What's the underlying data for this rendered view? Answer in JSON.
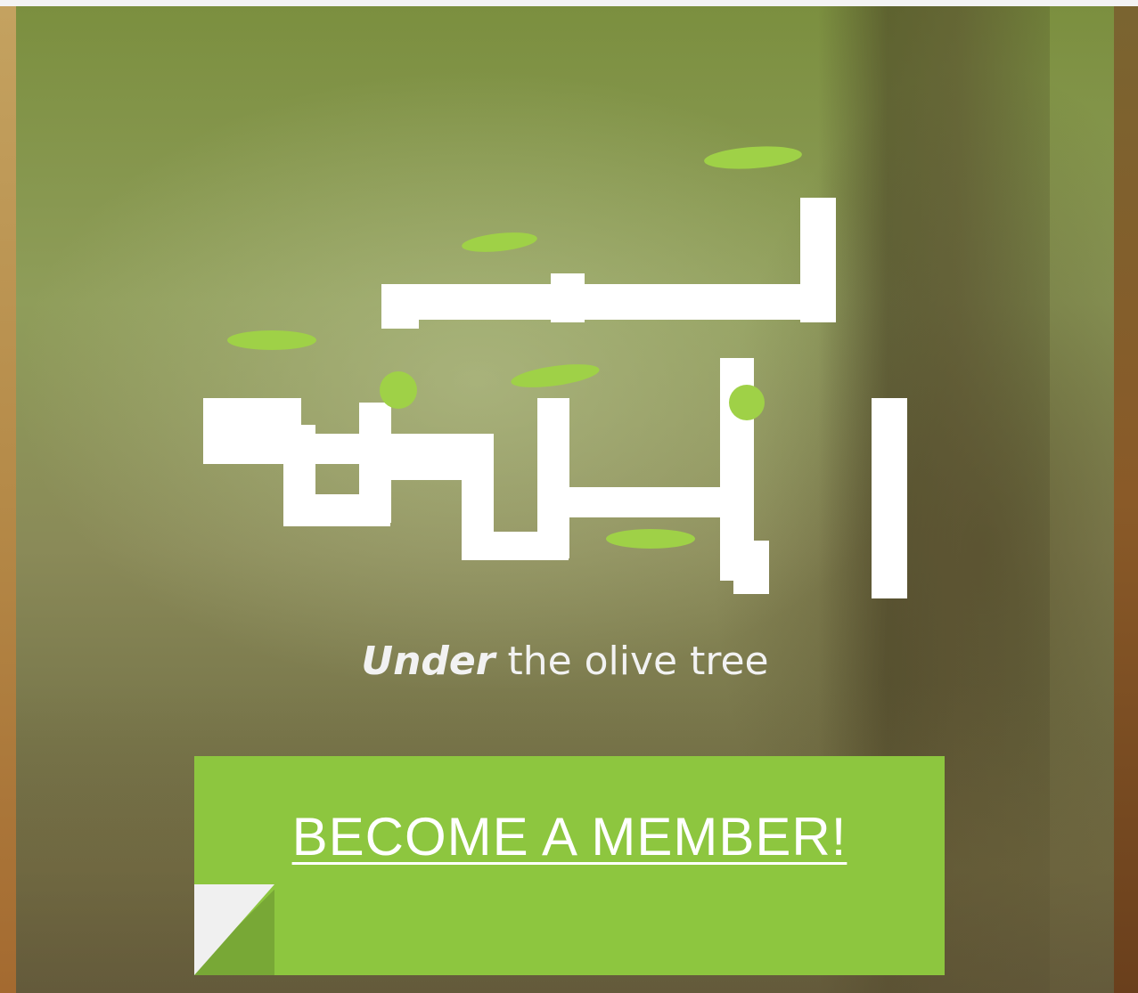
{
  "poster": {
    "logo_arabic": "تحت الزيتونة",
    "tagline_bold": "Under",
    "tagline_rest": " the olive tree"
  },
  "cta": {
    "label": "BECOME A MEMBER!"
  },
  "colors": {
    "accent_green": "#8dc63f",
    "leaf_green": "#9fd147",
    "text_white": "#ffffff"
  },
  "icons": [
    "olive-leaf-icon",
    "page-fold-icon"
  ]
}
